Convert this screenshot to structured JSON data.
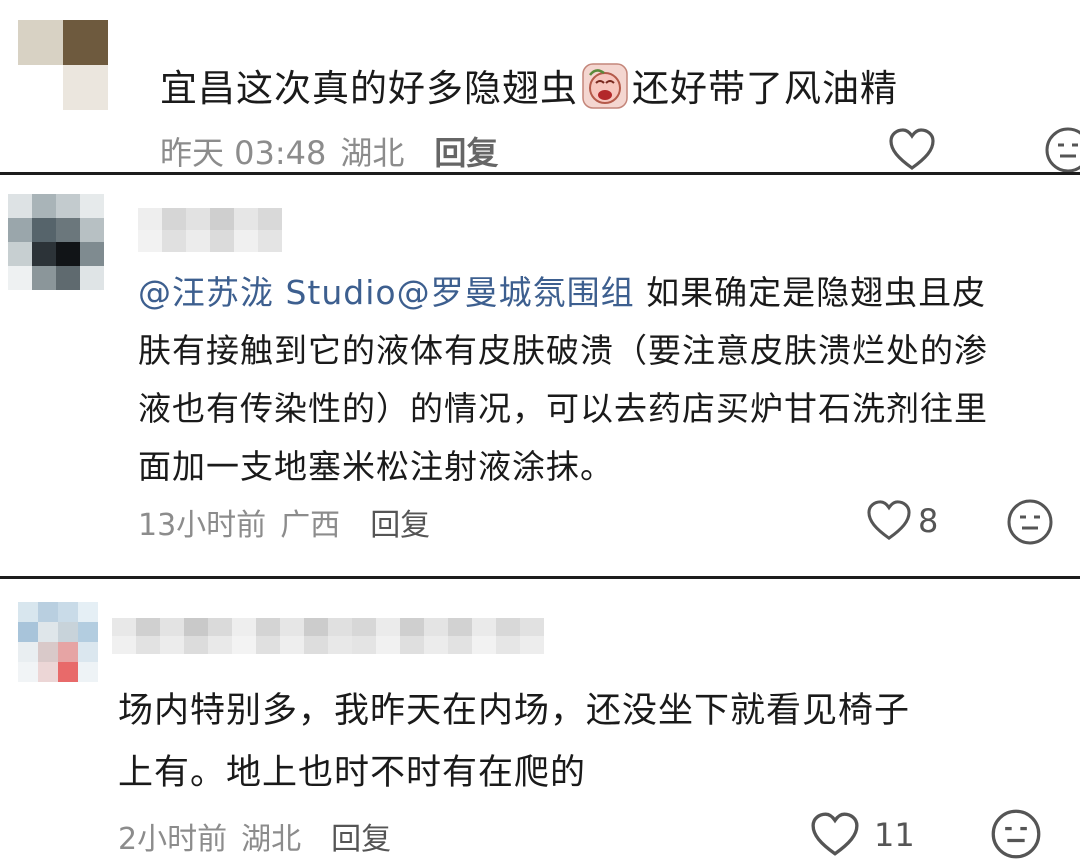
{
  "comments": [
    {
      "text_before_emoji": "宜昌这次真的好多隐翅虫",
      "emoji": "crying-face-emoji",
      "text_after_emoji": "还好带了风油精",
      "time": "昨天 03:48",
      "location": "湖北",
      "reply_label": "回复",
      "likes": ""
    },
    {
      "mention": "@汪苏泷 Studio@罗曼城氛围组",
      "text": " 如果确定是隐翅虫且皮肤有接触到它的液体有皮肤破溃（要注意皮肤溃烂处的渗液也有传染性的）的情况，可以去药店买炉甘石洗剂往里面加一支地塞米松注射液涂抹。",
      "lines": [
        "@汪苏泷 Studio@罗曼城氛围组 如果确定是隐翅虫且皮",
        "肤有接触到它的液体有皮肤破溃（要注意皮肤溃烂处的渗",
        "液也有传染性的）的情况，可以去药店买炉甘石洗剂往里",
        "面加一支地塞米松注射液涂抹。"
      ],
      "time": "13小时前",
      "location": "广西",
      "reply_label": "回复",
      "likes": "8"
    },
    {
      "lines": [
        "场内特别多，我昨天在内场，还没坐下就看见椅子",
        "上有。地上也时不时有在爬的"
      ],
      "time": "2小时前",
      "location": "湖北",
      "reply_label": "回复",
      "likes": "11"
    }
  ],
  "icons": {
    "like": "heart-outline-icon",
    "emoji_reaction": "expressionless-face-icon"
  },
  "colors": {
    "text": "#1a1a1a",
    "meta": "#8c8c8c",
    "mention": "#3d5f8f",
    "divider": "#1c1c1c"
  }
}
